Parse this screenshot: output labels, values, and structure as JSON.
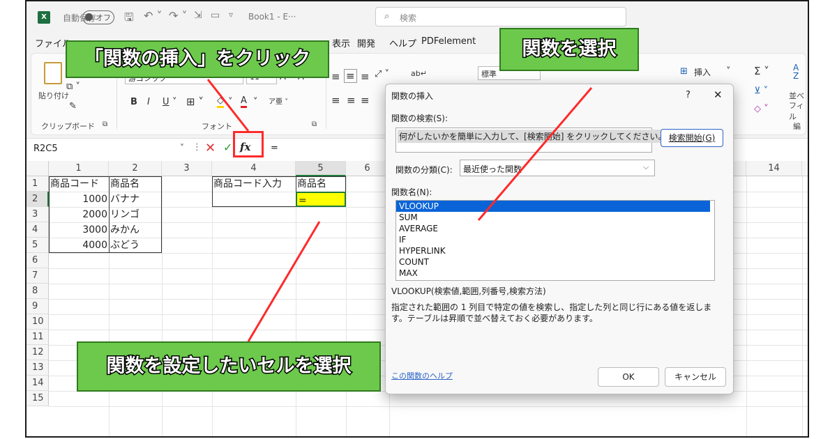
{
  "titlebar": {
    "autosave_label": "自動保存",
    "autosave_state": "オフ",
    "doc_title": "Book1 - E···",
    "search_placeholder": "検索"
  },
  "menu": [
    "ファイル",
    "表示",
    "開発",
    "ヘルプ",
    "PDFelement"
  ],
  "ribbon": {
    "paste_label": "貼り付け",
    "clipboard_group": "クリップボード",
    "font_group": "フォント",
    "font_name": "游ゴシック",
    "font_size": "11",
    "bold": "B",
    "italic": "I",
    "underline": "U",
    "number_format": "標準",
    "insert_label": "挿入",
    "sort_label": "並べ",
    "filter_label": "フィル",
    "edit_group": "編"
  },
  "formula_bar": {
    "name_box": "R2C5",
    "fx": "fx",
    "content": "="
  },
  "grid": {
    "columns": [
      "1",
      "2",
      "3",
      "4",
      "5",
      "6",
      "14"
    ],
    "rows": [
      "1",
      "2",
      "3",
      "4",
      "5",
      "6",
      "7",
      "8",
      "9",
      "10",
      "11",
      "12",
      "13",
      "14",
      "15"
    ],
    "header_row": [
      "商品コード",
      "商品名",
      "",
      "商品コード入力",
      "商品名"
    ],
    "data": [
      {
        "code": "1000",
        "name": "バナナ"
      },
      {
        "code": "2000",
        "name": "リンゴ"
      },
      {
        "code": "3000",
        "name": "みかん"
      },
      {
        "code": "4000",
        "name": "ぶどう"
      }
    ],
    "active_cell_value": "="
  },
  "dialog": {
    "title": "関数の挿入",
    "help_char": "?",
    "close_char": "✕",
    "search_label": "関数の検索(S):",
    "search_value": "何がしたいかを簡単に入力して、[検索開始] をクリックしてください。",
    "search_button": "検索開始(G)",
    "category_label": "関数の分類(C):",
    "category_value": "最近使った関数",
    "function_name_label": "関数名(N):",
    "functions": [
      "VLOOKUP",
      "SUM",
      "AVERAGE",
      "IF",
      "HYPERLINK",
      "COUNT",
      "MAX"
    ],
    "selected_function": "VLOOKUP",
    "signature": "VLOOKUP(検索値,範囲,列番号,検索方法)",
    "description": "指定された範囲の 1 列目で特定の値を検索し、指定した列と同じ行にある値を返します。テーブルは昇順で並べ替えておく必要があります。",
    "help_link": "この関数のヘルプ",
    "ok_button": "OK",
    "cancel_button": "キャンセル"
  },
  "callouts": {
    "insert_function": "「関数の挿入」をクリック",
    "select_function": "関数を選択",
    "select_cell": "関数を設定したいセルを選択"
  },
  "colors": {
    "callout_fill": "#6cc94c",
    "arrow": "#ff2a2a",
    "selection": "#0a64d8",
    "active_cell": "#ffff00"
  }
}
